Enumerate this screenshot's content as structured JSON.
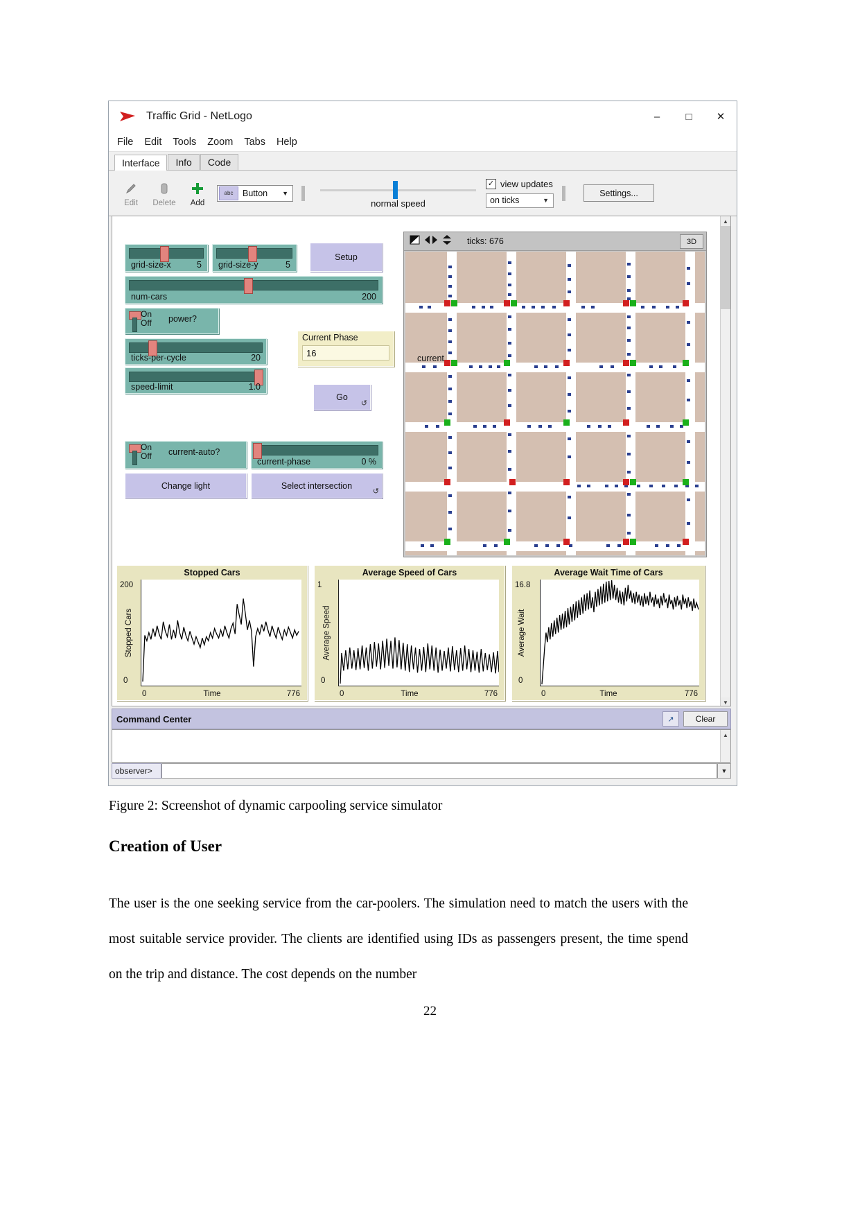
{
  "window": {
    "title": "Traffic Grid - NetLogo",
    "logo_icon": "netlogo-arrow-icon",
    "minimize": "–",
    "maximize": "□",
    "close": "✕"
  },
  "menu": [
    "File",
    "Edit",
    "Tools",
    "Zoom",
    "Tabs",
    "Help"
  ],
  "tabs": [
    {
      "label": "Interface",
      "active": true
    },
    {
      "label": "Info",
      "active": false
    },
    {
      "label": "Code",
      "active": false
    }
  ],
  "toolbar": {
    "edit_label": "Edit",
    "delete_label": "Delete",
    "add_label": "Add",
    "widget_type": "Button",
    "widget_chip": "abc",
    "speed_label": "normal speed",
    "view_updates_label": "view updates",
    "view_updates_checked": "✓",
    "update_mode": "on ticks",
    "settings_label": "Settings...",
    "caret": "⌄"
  },
  "controls": {
    "sliders": [
      {
        "name": "grid-size-x",
        "value": "5",
        "fill_pct": 45
      },
      {
        "name": "grid-size-y",
        "value": "5",
        "fill_pct": 45
      },
      {
        "name": "num-cars",
        "value": "200",
        "fill_pct": 47
      },
      {
        "name": "ticks-per-cycle",
        "value": "20",
        "fill_pct": 18
      },
      {
        "name": "speed-limit",
        "value": "1.0",
        "fill_pct": 97
      },
      {
        "name": "current-phase",
        "value": "0 %",
        "fill_pct": 1
      }
    ],
    "switches": [
      {
        "name": "power?",
        "on_label": "On",
        "off_label": "Off",
        "state": "On"
      },
      {
        "name": "current-auto?",
        "on_label": "On",
        "off_label": "Off",
        "state": "On"
      }
    ],
    "buttons": [
      {
        "label": "Setup",
        "forever": false
      },
      {
        "label": "Go",
        "forever": true
      },
      {
        "label": "Change light",
        "forever": false
      },
      {
        "label": "Select intersection",
        "forever": true
      }
    ],
    "monitor": {
      "title": "Current Phase",
      "value": "16"
    },
    "forever_icon": "↺"
  },
  "view": {
    "ticks_label": "ticks: 676",
    "button_3d": "3D",
    "world_label": "current",
    "tool_icons": [
      "select-tool-icon",
      "pan-horizontal-icon",
      "pan-vertical-icon"
    ]
  },
  "plots": [
    {
      "title": "Stopped Cars",
      "ylabel": "Stopped Cars",
      "xlabel": "Time",
      "ymax": "200",
      "ymin": "0",
      "xmin": "0",
      "xmax": "776"
    },
    {
      "title": "Average Speed of Cars",
      "ylabel": "Average Speed",
      "xlabel": "Time",
      "ymax": "1",
      "ymin": "0",
      "xmin": "0",
      "xmax": "776"
    },
    {
      "title": "Average Wait Time of Cars",
      "ylabel": "Average Wait",
      "xlabel": "Time",
      "ymax": "16.8",
      "ymin": "0",
      "xmin": "0",
      "xmax": "776"
    }
  ],
  "chart_data": [
    {
      "type": "line",
      "title": "Stopped Cars",
      "xlabel": "Time",
      "ylabel": "Stopped Cars",
      "xlim": [
        0,
        776
      ],
      "ylim": [
        0,
        200
      ],
      "grid": false,
      "legend": "none",
      "series": [
        {
          "name": "stopped cars",
          "values": [
            8,
            96,
            88,
            104,
            92,
            110,
            98,
            116,
            104,
            94,
            122,
            108,
            100,
            118,
            96,
            112,
            100,
            124,
            106,
            96,
            114,
            102,
            92,
            108,
            98,
            88,
            100,
            90,
            82,
            96,
            86,
            100,
            92,
            106,
            96,
            112,
            104,
            96,
            110,
            100,
            116,
            106,
            98,
            112,
            120,
            104,
            150,
            132,
            118,
            158,
            136,
            112,
            126,
            110,
            60,
            98,
            112,
            104,
            118,
            108,
            122,
            110,
            100,
            116,
            106,
            98,
            114,
            104,
            96,
            110,
            100,
            112,
            104,
            118,
            108,
            100,
            112,
            104,
            110
          ]
        }
      ]
    },
    {
      "type": "line",
      "title": "Average Speed of Cars",
      "xlabel": "Time",
      "ylabel": "Average Speed",
      "xlim": [
        0,
        776
      ],
      "ylim": [
        0,
        1
      ],
      "grid": false,
      "legend": "none",
      "series": [
        {
          "name": "average speed",
          "values": [
            0.02,
            0.3,
            0.12,
            0.34,
            0.14,
            0.36,
            0.16,
            0.33,
            0.13,
            0.35,
            0.15,
            0.38,
            0.17,
            0.36,
            0.14,
            0.39,
            0.16,
            0.41,
            0.18,
            0.4,
            0.16,
            0.42,
            0.17,
            0.44,
            0.19,
            0.42,
            0.17,
            0.45,
            0.18,
            0.43,
            0.16,
            0.41,
            0.15,
            0.4,
            0.14,
            0.38,
            0.16,
            0.36,
            0.13,
            0.35,
            0.15,
            0.37,
            0.14,
            0.39,
            0.16,
            0.38,
            0.15,
            0.36,
            0.13,
            0.34,
            0.15,
            0.33,
            0.12,
            0.35,
            0.14,
            0.37,
            0.15,
            0.34,
            0.13,
            0.36,
            0.14,
            0.38,
            0.15,
            0.35,
            0.13,
            0.34,
            0.14,
            0.33,
            0.12,
            0.35,
            0.13,
            0.32,
            0.14,
            0.31,
            0.13,
            0.33,
            0.14,
            0.3,
            0.12,
            0.32
          ]
        }
      ]
    },
    {
      "type": "line",
      "title": "Average Wait Time of Cars",
      "xlabel": "Time",
      "ylabel": "Average Wait",
      "xlim": [
        0,
        776
      ],
      "ylim": [
        0,
        16.8
      ],
      "grid": false,
      "legend": "none",
      "series": [
        {
          "name": "average wait",
          "values": [
            0.2,
            3.0,
            6.0,
            8.4,
            7.0,
            9.2,
            7.4,
            9.8,
            7.8,
            10.2,
            8.2,
            10.6,
            8.4,
            11.0,
            8.8,
            11.2,
            9.0,
            11.6,
            9.2,
            12.0,
            9.6,
            12.2,
            9.8,
            12.6,
            10.0,
            13.0,
            10.4,
            13.2,
            10.6,
            13.6,
            10.8,
            14.0,
            11.2,
            14.2,
            11.4,
            14.6,
            11.6,
            13.8,
            11.0,
            14.4,
            11.8,
            14.8,
            12.0,
            15.2,
            12.2,
            15.6,
            12.4,
            16.0,
            12.6,
            16.4,
            12.8,
            16.8,
            13.0,
            16.2,
            12.6,
            15.8,
            12.4,
            15.4,
            12.2,
            15.0,
            12.0,
            15.6,
            12.4,
            16.0,
            12.8,
            15.2,
            12.2,
            14.8,
            12.0,
            15.0,
            12.2,
            14.6,
            11.8,
            14.2,
            11.6,
            14.8,
            12.0,
            14.4,
            11.8,
            14.0
          ]
        }
      ]
    }
  ],
  "command_center": {
    "title": "Command Center",
    "popout_icon": "popout-icon",
    "clear_label": "Clear",
    "prompt": "observer>",
    "scroll_down_icon": "▼"
  },
  "document": {
    "figure_caption": "Figure 2: Screenshot of dynamic carpooling service simulator",
    "heading": "Creation of User",
    "paragraph": "The user is the one seeking service from the car-poolers. The simulation need to match the users with the most suitable service provider. The clients are identified using IDs as passengers present, the time spend on the trip and distance. The cost depends on the number",
    "page_number": "22"
  },
  "colors": {
    "slider_bg": "#79b5ab",
    "button_bg": "#c6c3e8",
    "monitor_bg": "#f2eec8",
    "plot_bg": "#e8e5c0",
    "world_bg": "#d4bfb1",
    "accent_blue": "#0a7fd6",
    "thumb_red": "#e2847e"
  }
}
